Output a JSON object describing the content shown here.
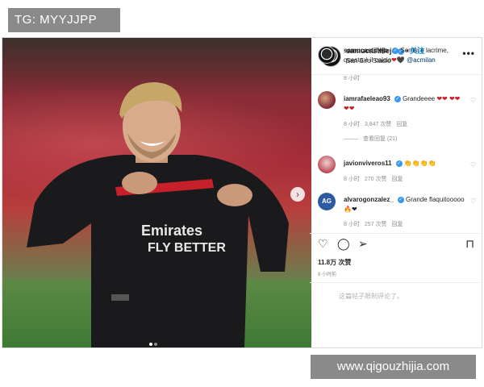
{
  "watermarks": {
    "top": "TG: MYYJJPP",
    "bottom": "www.qigouzhijia.com"
  },
  "header": {
    "username": "samucastillejo",
    "separator": "•",
    "follow_label": "关注",
    "location": "San Siro Stadio",
    "more_icon": "•••"
  },
  "photo": {
    "description_icon": "player-photo",
    "next_arrow": "›"
  },
  "caption": {
    "username": "samucastillejo",
    "text": "Sorrisi e lacrime, questo è il calcio",
    "hearts": "❤🖤",
    "mention": "@acmilan",
    "time": "8 小时"
  },
  "comments": [
    {
      "username": "iamrafaeleao93",
      "text": "Grandeeee",
      "emoji": "❤❤ ❤❤❤❤",
      "time": "8 小时",
      "likes": "3,847 次赞",
      "action": "回复",
      "replies": "查看回复 (21)"
    },
    {
      "username": "javionviveros11",
      "text": "",
      "emoji": "👏👏👏👏",
      "time": "8 小时",
      "likes": "270 次赞",
      "action": "回复"
    },
    {
      "username": "alvarogonzalez_",
      "text": "Grande flaquitooooo",
      "emoji": "🔥❤",
      "time": "8 小时",
      "likes": "257 次赞",
      "action": "回复",
      "avatar_text": "AG"
    }
  ],
  "actions": {
    "like_icon": "♡",
    "comment_icon": "◯",
    "share_icon": "➢",
    "save_icon": "⊓"
  },
  "likes_count": "11.8万 次赞",
  "post_time": "8 小时前",
  "add_comment_placeholder": "这篇帖子限制评论了。"
}
